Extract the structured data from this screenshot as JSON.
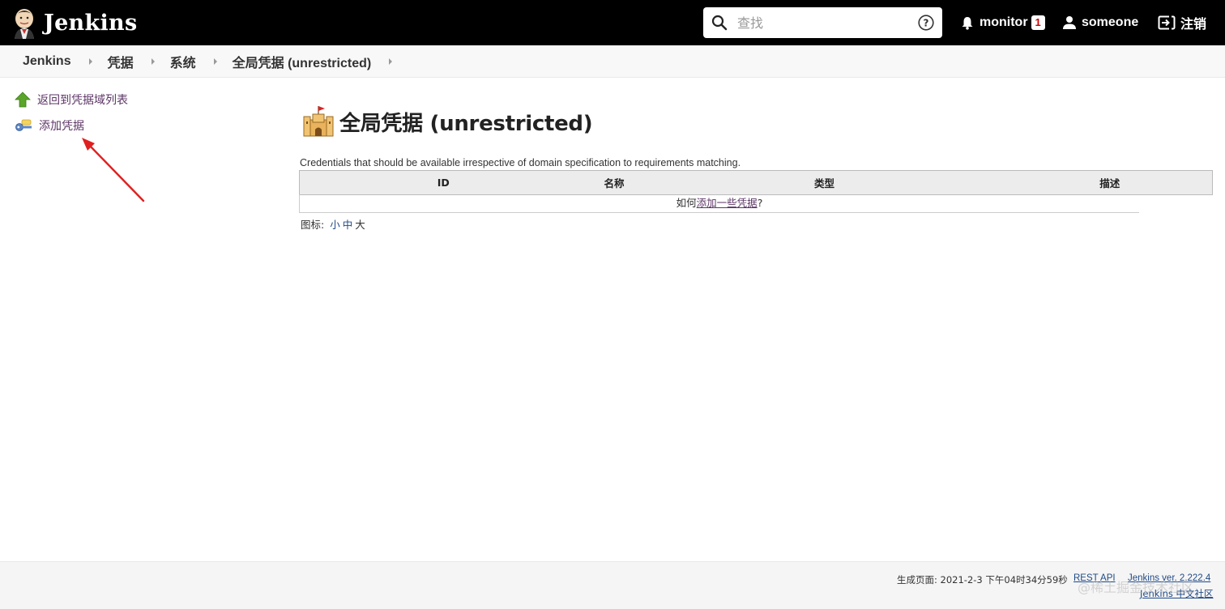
{
  "header": {
    "app_name": "Jenkins",
    "search_placeholder": "查找",
    "monitor_label": "monitor",
    "monitor_count": "1",
    "user_name": "someone",
    "logout_label": "注销"
  },
  "breadcrumb": [
    "Jenkins",
    "凭据",
    "系统",
    "全局凭据 (unrestricted)"
  ],
  "side_panel": {
    "back_label": "返回到凭据域列表",
    "add_label": "添加凭据"
  },
  "main": {
    "title": "全局凭据 (unrestricted)",
    "description": "Credentials that should be available irrespective of domain specification to requirements matching.",
    "table_headers": [
      "ID",
      "名称",
      "类型",
      "描述"
    ],
    "empty_prefix": "如何",
    "empty_link": "添加一些凭据",
    "empty_suffix": "?",
    "icon_label": "图标:",
    "icon_sizes": [
      "小",
      "中",
      "大"
    ]
  },
  "footer": {
    "generated": "生成页面: 2021-2-3 下午04时34分59秒",
    "rest_api": "REST API",
    "version": "Jenkins ver. 2.222.4",
    "community": "Jenkins 中文社区"
  },
  "watermark": "@稀土掘金技术社区",
  "colors": {
    "header_bg": "#000000",
    "link": "#5c3566",
    "arrow": "#e02020"
  }
}
